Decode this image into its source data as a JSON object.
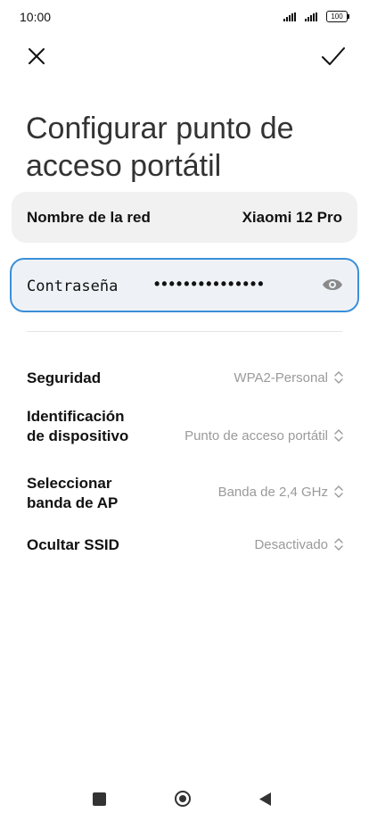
{
  "status_bar": {
    "time": "10:00",
    "battery": "100"
  },
  "title": "Configurar punto de acceso portátil",
  "network": {
    "label": "Nombre de la red",
    "value": "Xiaomi 12 Pro"
  },
  "password": {
    "label": "Contraseña",
    "value": "•••••••••••••••"
  },
  "settings": [
    {
      "label": "Seguridad",
      "value": "WPA2-Personal"
    },
    {
      "label": "Identificación de dispositivo",
      "value": "Punto de acceso portátil"
    },
    {
      "label": "Seleccionar banda de AP",
      "value": "Banda de 2,4 GHz"
    },
    {
      "label": "Ocultar SSID",
      "value": "Desactivado"
    }
  ],
  "icons": {
    "close": "close-icon",
    "confirm": "check-icon",
    "eye": "eye-icon",
    "chevron": "chevron-updown-icon",
    "nav_recent": "recent-apps-icon",
    "nav_home": "home-icon",
    "nav_back": "back-icon"
  },
  "colors": {
    "accent": "#3b8fd9",
    "card_bg": "#f1f1f1",
    "secondary_text": "#9a9a9a"
  }
}
